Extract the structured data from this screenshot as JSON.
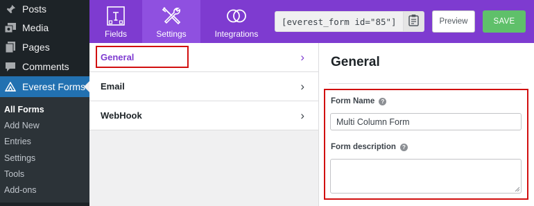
{
  "wp_menu": {
    "items": [
      {
        "label": "Posts",
        "icon": "pushpin-icon"
      },
      {
        "label": "Media",
        "icon": "media-icon"
      },
      {
        "label": "Pages",
        "icon": "pages-icon"
      },
      {
        "label": "Comments",
        "icon": "comments-icon"
      },
      {
        "label": "Everest Forms",
        "icon": "everest-forms-icon",
        "current": true
      }
    ],
    "submenu": [
      {
        "label": "All Forms",
        "active": true
      },
      {
        "label": "Add New"
      },
      {
        "label": "Entries"
      },
      {
        "label": "Settings"
      },
      {
        "label": "Tools"
      },
      {
        "label": "Add-ons"
      }
    ]
  },
  "builder": {
    "tabs": [
      {
        "label": "Fields",
        "icon": "fields-icon"
      },
      {
        "label": "Settings",
        "icon": "settings-tools-icon",
        "active": true
      },
      {
        "label": "Integrations",
        "icon": "integrations-icon"
      }
    ],
    "shortcode": "[everest_form id=\"85\"]",
    "preview_label": "Preview",
    "save_label": "SAVE"
  },
  "settings_nav": {
    "items": [
      {
        "label": "General",
        "active": true
      },
      {
        "label": "Email"
      },
      {
        "label": "WebHook"
      }
    ]
  },
  "general_panel": {
    "title": "General",
    "form_name_label": "Form Name",
    "form_name_value": "Multi Column Form",
    "form_description_label": "Form description",
    "form_description_value": ""
  },
  "colors": {
    "builder_purple": "#7e3bd0",
    "active_tab_purple": "#8f50e0",
    "save_green": "#5fc06a",
    "wp_sidebar": "#1d2327",
    "wp_current": "#2271b1",
    "highlight_red": "#d10f0f"
  }
}
